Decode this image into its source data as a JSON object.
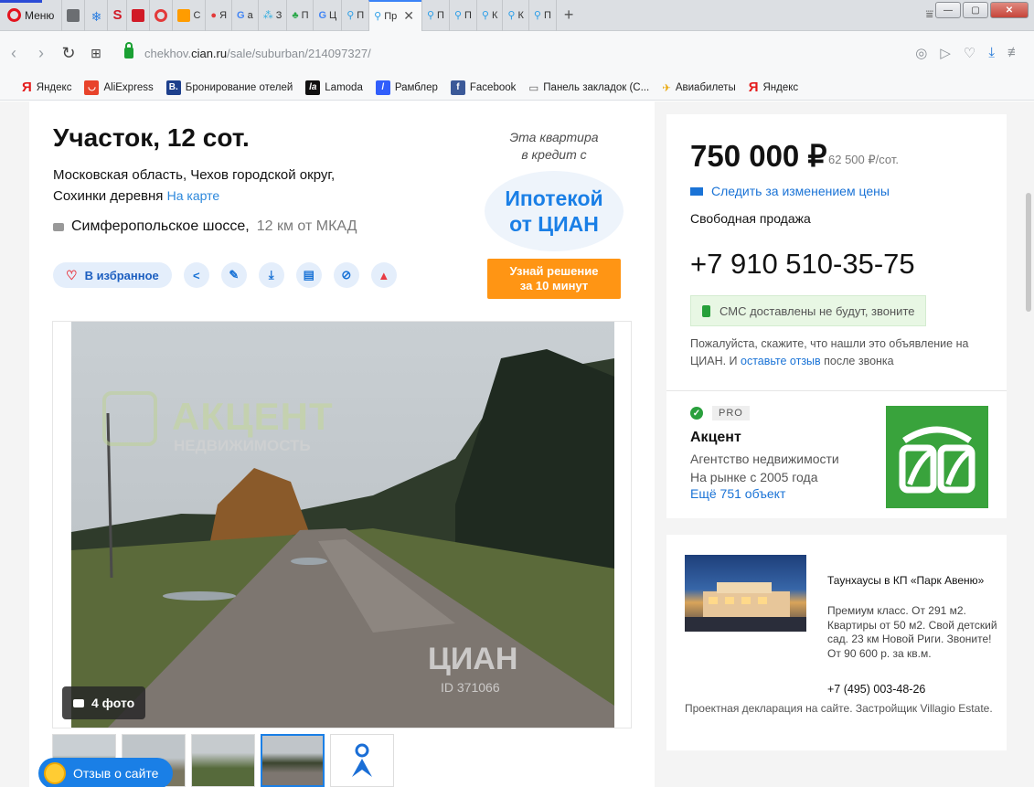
{
  "browser": {
    "menu_label": "Меню",
    "tabs": [
      {
        "label": "",
        "color": "#6b6e72"
      },
      {
        "label": "",
        "color": "#2a7de1"
      },
      {
        "label": "S",
        "color": "#d11a27"
      },
      {
        "label": "",
        "color": "#d11a27"
      },
      {
        "label": "",
        "color": "#e33a3a"
      },
      {
        "label": "С",
        "color": "#ff9c00"
      },
      {
        "label": "Я",
        "color": "#d93a3a"
      },
      {
        "label": "a",
        "color": "#4285f4"
      },
      {
        "label": "З",
        "color": "#33aee0"
      },
      {
        "label": "П",
        "color": "#2ba84a"
      },
      {
        "label": "Ц",
        "color": "#4285f4"
      },
      {
        "label": "П",
        "color": "#2a9ee8"
      }
    ],
    "active_tab": "Пр",
    "tabs_right": [
      "П",
      "П",
      "К",
      "К",
      "П"
    ],
    "new_tab": "+",
    "url_host": "chekhov.cian.ru",
    "url_path": "/sale/suburban/214097327/",
    "bookmarks": [
      "Яндекс",
      "AliExpress",
      "Бронирование отелей",
      "Lamoda",
      "Рамблер",
      "Facebook",
      "Панель закладок (С...",
      "Авиабилеты",
      "Яндекс"
    ]
  },
  "listing": {
    "title": "Участок, 12 сот.",
    "address_line1": "Московская область, Чехов городской округ,",
    "address_line2": "Сохинки деревня",
    "map_link": "На карте",
    "highway": "Симферопольское шоссе,",
    "distance": "12 км от МКАД",
    "favorite_label": "В избранное",
    "photo_count": "4 фото",
    "watermark_name": "АКЦЕНТ",
    "watermark_sub": "НЕДВИЖИМОСТЬ",
    "watermark_cian": "ЦИАН",
    "watermark_id": "ID 371066",
    "feedback_label": "Отзыв о сайте"
  },
  "promo": {
    "line1": "Эта квартира",
    "line2": "в кредит с",
    "big1": "Ипотекой",
    "big2": "от ЦИАН",
    "cta1": "Узнай решение",
    "cta2": "за 10 минут"
  },
  "price": {
    "value": "750 000 ₽",
    "per_unit": "62 500 ₽/сот.",
    "watch_label": "Следить за изменением цены",
    "sale_type": "Свободная продажа",
    "phone": "+7 910 510-35-75",
    "sms_note": "СМС доставлены не будут, звоните",
    "note_part1": "Пожалуйста, скажите, что нашли это объявление на ЦИАН. И ",
    "note_link": "оставьте отзыв",
    "note_part2": " после звонка"
  },
  "agent": {
    "badge": "PRO",
    "name": "Акцент",
    "type_line1": "Агентство недвижимости",
    "type_line2": "На рынке с 2005 года",
    "more": "Ещё 751 объект",
    "logo_color": "#39a33c"
  },
  "ad": {
    "title": "Таунхаусы в КП «Парк Авеню»",
    "text": "Премиум класс. От 291 м2. Квартиры от 50 м2. Свой детский сад. 23 км Новой Риги. Звоните! От 90 600 р. за кв.м.",
    "phone": "+7 (495) 003-48-26",
    "declaration": "Проектная декларация на сайте. Застройщик Villagio Estate."
  }
}
